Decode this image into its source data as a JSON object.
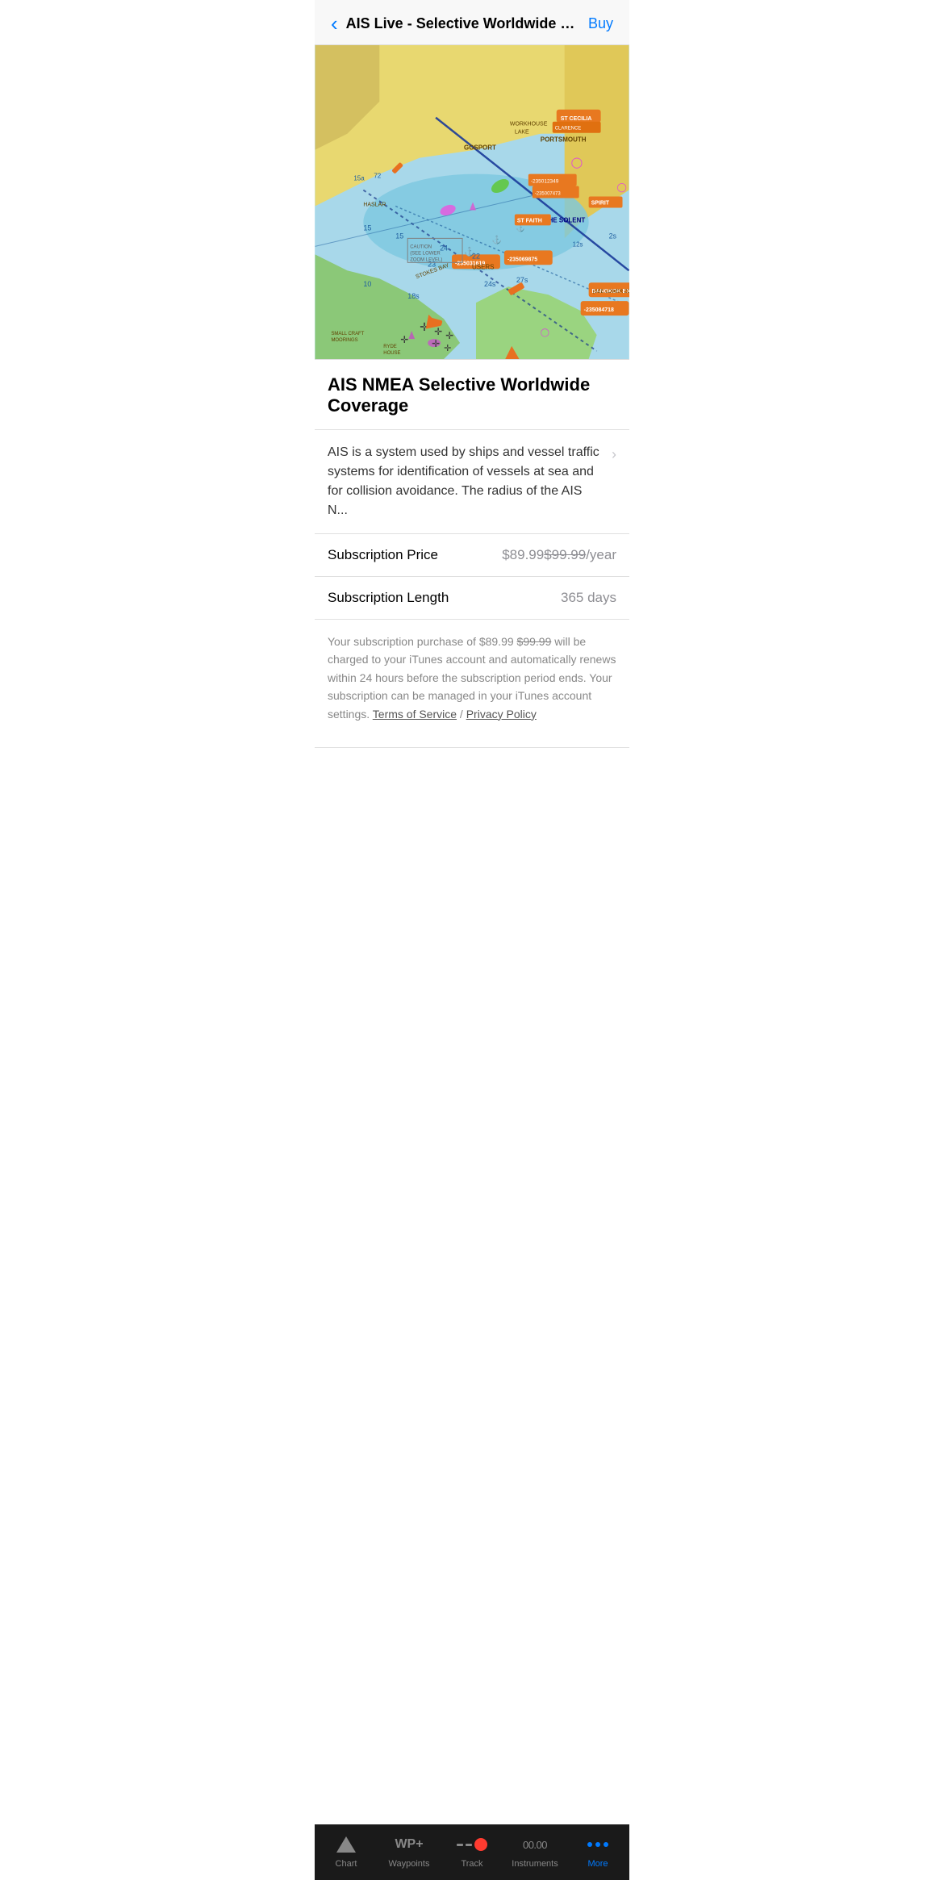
{
  "header": {
    "back_label": "‹",
    "title": "AIS Live - Selective Worldwide Co...",
    "buy_label": "Buy"
  },
  "product": {
    "name": "AIS NMEA Selective Worldwide Coverage",
    "description": "AIS is a system used by ships and vessel traffic systems for identification of vessels at sea and for collision avoidance. The radius of the AIS N...",
    "subscription_price_label": "Subscription Price",
    "subscription_price_value": "$89.99",
    "subscription_price_original": "$99.99",
    "subscription_price_period": "/year",
    "subscription_length_label": "Subscription Length",
    "subscription_length_value": "365 days",
    "disclaimer": "Your subscription purchase of $89.99 $99.99 will be charged to your iTunes account and automatically renews within 24 hours before the subscription period ends. Your subscription can be managed in your iTunes account settings.",
    "terms_label": "Terms of Service",
    "privacy_label": "Privacy Policy"
  },
  "tab_bar": {
    "chart_label": "Chart",
    "waypoints_label": "Waypoints",
    "waypoints_icon": "WP+",
    "track_label": "Track",
    "instruments_label": "Instruments",
    "instruments_icon": "00.00",
    "more_label": "More"
  }
}
